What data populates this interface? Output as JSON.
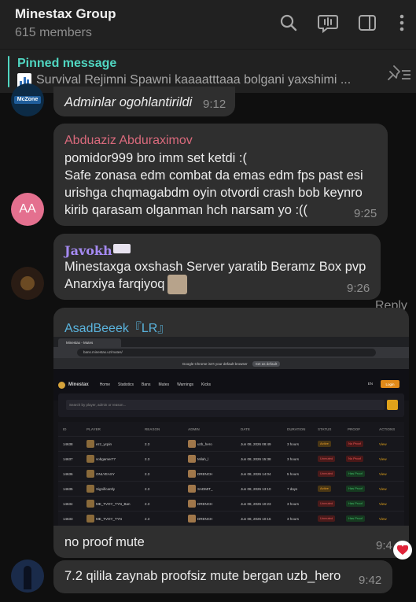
{
  "header": {
    "title": "Minestax Group",
    "members": "615 members"
  },
  "pinned": {
    "title": "Pinned message",
    "text": "Survival Rejimni Spawni kaaaatttaaa bolgani yaxshimi ..."
  },
  "messages": [
    {
      "text": "Adminlar ogohlantirildi",
      "time": "9:12",
      "avatar_label": "McZone"
    },
    {
      "sender": "Abduaziz Abduraximov",
      "sender_color": "#d96a7c",
      "lines": [
        "pomidor999 bro imm set ketdi :(",
        "Safe zonasa edm combat da emas edm fps past esi",
        "urishga chqmagabdm oyin otvordi crash bob keynro",
        "kirib qarasam olganman hch narsam yo :(("
      ],
      "time": "9:25",
      "avatar_initials": "AA",
      "avatar_color": "#e4708f"
    },
    {
      "sender": "Javokh",
      "sender_color": "#a58af2",
      "lines": [
        "Minestaxga oxshash Server yaratib Beramz Box pvp",
        "Anarxiya farqiyoq"
      ],
      "time": "9:26"
    },
    {
      "sender": "AsadBeeek『LR』",
      "sender_color": "#5ab4de",
      "caption": "no proof mute",
      "time": "9:4",
      "reply_label": "Reply"
    },
    {
      "text": "7.2 qilila zaynab proofsiz mute bergan uzb_hero",
      "time": "9:42"
    }
  ],
  "screenshot": {
    "tab": "Minestax - Mutes",
    "url": "bans.minestax.uz/mutes/",
    "notice": "Google Chrome isn't your default browser",
    "notice_btn": "Set as default",
    "brand": "Minestax",
    "nav": [
      "Home",
      "Statistics",
      "Bans",
      "Mutes",
      "Warnings",
      "Kicks"
    ],
    "lang": "EN",
    "login": "Login",
    "search_placeholder": "Search by player, admin or reason...",
    "columns": [
      "ID",
      "PLAYER",
      "REASON",
      "ADMIN",
      "DATE",
      "DURATION",
      "STATUS",
      "PROOF",
      "ACTIONS"
    ],
    "rows": [
      {
        "id": "14638",
        "player": "ezz_ycpin",
        "reason": "2.3",
        "admin": "uzb_hero",
        "date": "Jun 08, 2026 08:49",
        "duration": "3 hours",
        "status": "Active",
        "proof": "No Proof",
        "action": "View"
      },
      {
        "id": "14637",
        "player": "sobgamer77",
        "reason": "2.3",
        "admin": "Milah_l",
        "date": "Jun 08, 2026 15:38",
        "duration": "3 hours",
        "status": "Unmuted",
        "proof": "No Proof",
        "action": "View"
      },
      {
        "id": "14636",
        "player": "ONLYEASY",
        "reason": "2.3",
        "admin": "DRENCH",
        "date": "Jun 08, 2026 14:04",
        "duration": "5 hours",
        "status": "Unmuted",
        "proof": "Has Proof",
        "action": "View"
      },
      {
        "id": "14635",
        "player": "Significantly",
        "reason": "2.3",
        "admin": "SADMIT_",
        "date": "Jun 08, 2026 13:10",
        "duration": "7 days",
        "status": "Active",
        "proof": "Has Proof",
        "action": "View"
      },
      {
        "id": "14634",
        "player": "ME_TVOY_TYN_Ban",
        "reason": "2.3",
        "admin": "DRENCH",
        "date": "Jun 08, 2026 10:23",
        "duration": "3 hours",
        "status": "Unmuted",
        "proof": "Has Proof",
        "action": "View"
      },
      {
        "id": "14633",
        "player": "ME_TVOY_TYN",
        "reason": "2.3",
        "admin": "DRENCH",
        "date": "Jun 08, 2026 10:16",
        "duration": "3 hours",
        "status": "Unmuted",
        "proof": "Has Proof",
        "action": "View"
      }
    ]
  },
  "colors": {
    "accent": "#50d6c1",
    "bubble": "#2f2f2f",
    "header_bg": "#212121"
  }
}
